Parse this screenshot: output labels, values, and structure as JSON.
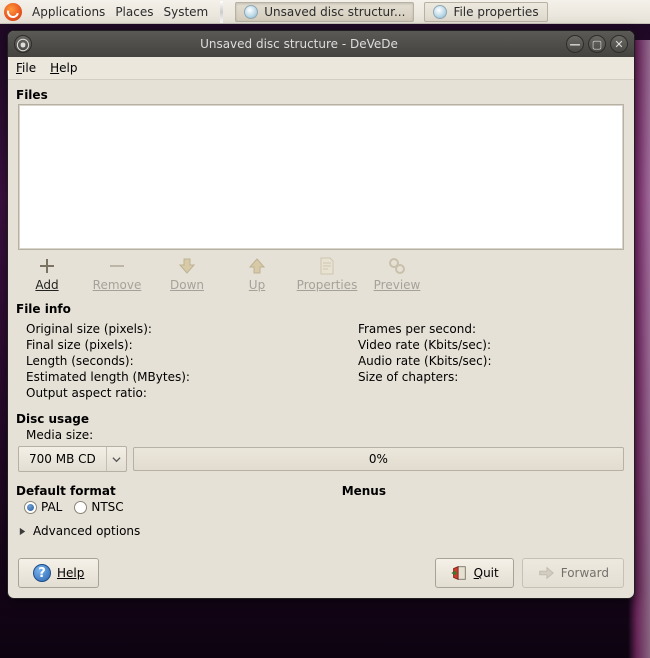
{
  "panel": {
    "menus": {
      "applications": "Applications",
      "places": "Places",
      "system": "System"
    },
    "tasks": {
      "t1": "Unsaved disc structur...",
      "t2": "File properties"
    }
  },
  "window": {
    "title": "Unsaved disc structure - DeVeDe",
    "menubar": {
      "file": "File",
      "help": "Help"
    },
    "files_label": "Files",
    "toolbar": {
      "add": "Add",
      "remove": "Remove",
      "down": "Down",
      "up": "Up",
      "properties": "Properties",
      "preview": "Preview"
    },
    "fileinfo": {
      "heading": "File info",
      "original_size": "Original size (pixels):",
      "final_size": "Final size (pixels):",
      "length": "Length (seconds):",
      "est_len": "Estimated length (MBytes):",
      "aspect": "Output aspect ratio:",
      "fps": "Frames per second:",
      "vrate": "Video rate (Kbits/sec):",
      "arate": "Audio rate (Kbits/sec):",
      "chapters": "Size of chapters:"
    },
    "disc": {
      "heading": "Disc usage",
      "media_label": "Media size:",
      "media_value": "700 MB CD",
      "progress": "0%"
    },
    "format": {
      "heading": "Default format",
      "pal": "PAL",
      "ntsc": "NTSC",
      "menus_heading": "Menus"
    },
    "advanced": "Advanced options",
    "buttons": {
      "help": "Help",
      "quit": "Quit",
      "forward": "Forward"
    }
  }
}
